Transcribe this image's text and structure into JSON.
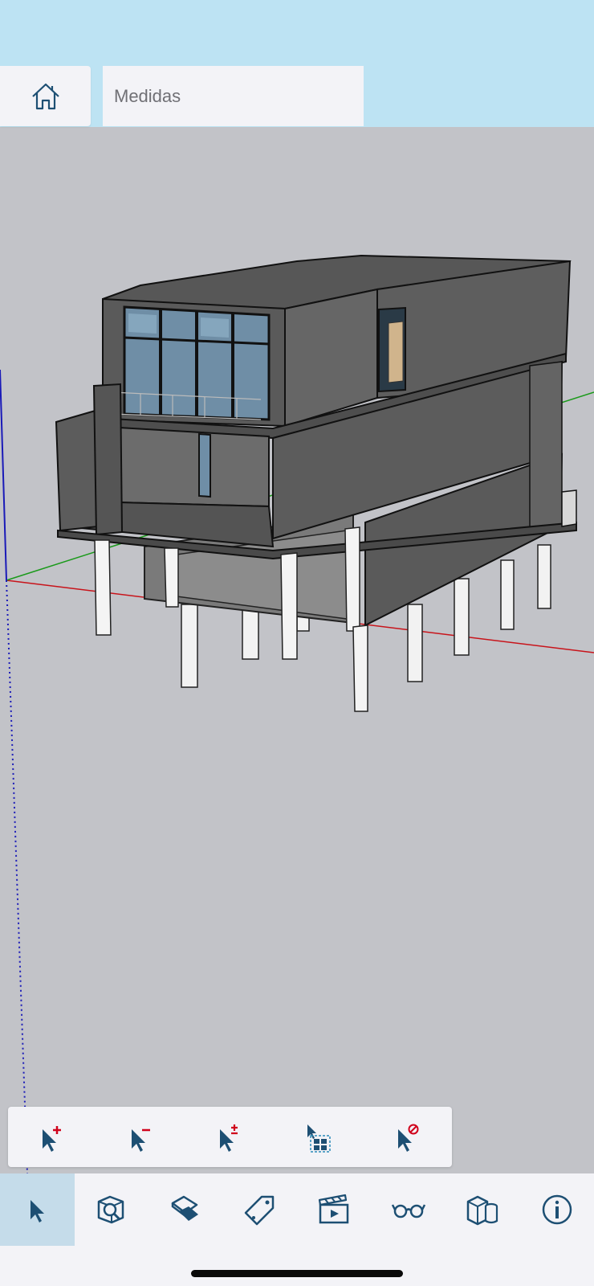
{
  "header": {
    "home_icon": "home-icon",
    "scene_tab_label": "Medidas"
  },
  "selection_toolbar": {
    "tools": [
      {
        "name": "select-add-tool",
        "icon": "cursor-plus-icon"
      },
      {
        "name": "select-subtract-tool",
        "icon": "cursor-minus-icon"
      },
      {
        "name": "select-toggle-tool",
        "icon": "cursor-plus-minus-icon"
      },
      {
        "name": "select-all-tool",
        "icon": "cursor-select-all-icon"
      },
      {
        "name": "select-none-tool",
        "icon": "cursor-clear-icon"
      }
    ]
  },
  "tab_bar": {
    "items": [
      {
        "name": "select-tab",
        "icon": "cursor-icon",
        "active": true
      },
      {
        "name": "view-tab",
        "icon": "cube-search-icon",
        "active": false
      },
      {
        "name": "section-tab",
        "icon": "section-plane-icon",
        "active": false
      },
      {
        "name": "tags-tab",
        "icon": "tag-icon",
        "active": false
      },
      {
        "name": "scenes-tab",
        "icon": "clapperboard-icon",
        "active": false
      },
      {
        "name": "style-tab",
        "icon": "glasses-icon",
        "active": false
      },
      {
        "name": "entities-tab",
        "icon": "components-icon",
        "active": false
      },
      {
        "name": "info-tab",
        "icon": "info-icon",
        "active": false
      }
    ]
  },
  "colors": {
    "sky": "#bde3f3",
    "ground": "#c2c3c8",
    "panel": "#f3f3f7",
    "icon": "#1d4f73",
    "accent_red": "#d0021b",
    "active_tab": "#c5dcea",
    "axis_red": "#c8141b",
    "axis_green": "#1a9a1a",
    "axis_blue": "#1a1ab8"
  }
}
